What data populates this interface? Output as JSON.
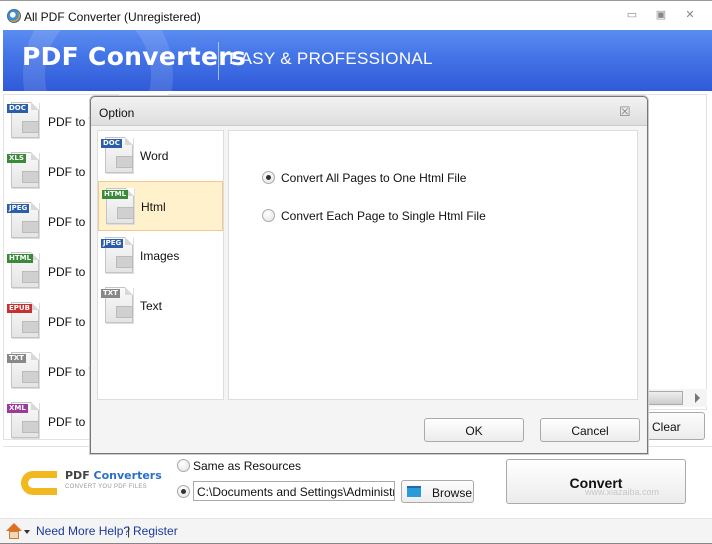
{
  "window": {
    "title": "All PDF Converter (Unregistered)",
    "controls": [
      "minimize",
      "maximize",
      "close"
    ]
  },
  "banner": {
    "brand": "PDF Converters",
    "tagline": "EASY & PROFESSIONAL"
  },
  "left_list": {
    "items": [
      {
        "badge": "DOC",
        "badge_color": "#2a5ea8",
        "label": "PDF to W"
      },
      {
        "badge": "XLS",
        "badge_color": "#3a8a3a",
        "label": "PDF to E"
      },
      {
        "badge": "JPEG",
        "badge_color": "#2a5ea8",
        "label": "PDF to I"
      },
      {
        "badge": "HTML",
        "badge_color": "#3a8a3a",
        "label": "PDF to H"
      },
      {
        "badge": "EPUB",
        "badge_color": "#c83030",
        "label": "PDF to E"
      },
      {
        "badge": "TXT",
        "badge_color": "#888888",
        "label": "PDF to T"
      },
      {
        "badge": "XML",
        "badge_color": "#9a3a9a",
        "label": "PDF to X"
      }
    ]
  },
  "main": {
    "clear_label": "Clear"
  },
  "dialog": {
    "title": "Option",
    "close_glyph": "☒",
    "categories": [
      {
        "badge": "DOC",
        "badge_color": "#2a5ea8",
        "label": "Word",
        "selected": false
      },
      {
        "badge": "HTML",
        "badge_color": "#3a8a3a",
        "label": "Html",
        "selected": true
      },
      {
        "badge": "JPEG",
        "badge_color": "#2a5ea8",
        "label": "Images",
        "selected": false
      },
      {
        "badge": "TXT",
        "badge_color": "#888888",
        "label": "Text",
        "selected": false
      }
    ],
    "options": [
      {
        "label": "Convert All Pages to One Html File",
        "checked": true
      },
      {
        "label": "Convert Each Page to Single Html File",
        "checked": false
      }
    ],
    "ok_label": "OK",
    "cancel_label": "Cancel"
  },
  "footer": {
    "logo_name_1": "PDF ",
    "logo_name_2": "Converters",
    "logo_sub": "CONVERT YOU PDF FILES",
    "output_same_label": "Same as Resources",
    "output_same_checked": false,
    "output_custom_checked": true,
    "output_path": "C:\\Documents and Settings\\Administrator",
    "browse_label": "Browse",
    "convert_label": "Convert"
  },
  "statusbar": {
    "help_link": "Need More Help?",
    "separator": "|",
    "register_link": "Register"
  },
  "watermark": "www.xiazaiba.com"
}
